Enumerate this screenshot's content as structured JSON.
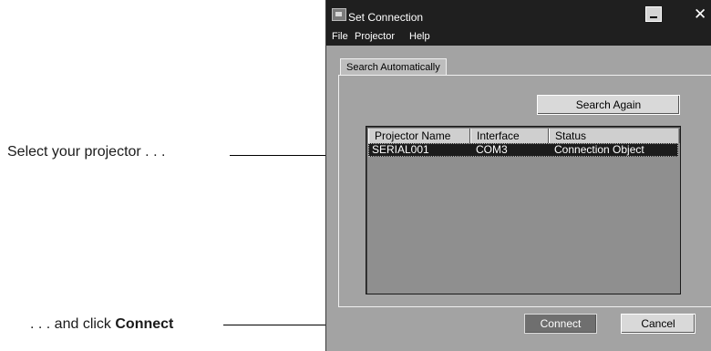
{
  "callouts": {
    "select": "Select your projector . . .",
    "click_prefix": ". . . and click ",
    "click_bold": "Connect"
  },
  "window": {
    "title": "Set Connection",
    "close_glyph": "✕",
    "icons": [
      "app-icon",
      "minimize-icon",
      "close-icon"
    ]
  },
  "menu": {
    "items": [
      "File",
      "Projector",
      "Help"
    ]
  },
  "tab": {
    "label": "Search Automatically"
  },
  "buttons": {
    "search_again": "Search Again",
    "connect": "Connect",
    "cancel": "Cancel"
  },
  "list": {
    "columns": [
      "Projector Name",
      "Interface",
      "Status"
    ],
    "rows": [
      [
        "SERIAL001",
        "COM3",
        "Connection Object"
      ]
    ],
    "selected_row": 0
  },
  "colors": {
    "selection": "#1c1c1c",
    "panel": "#a3a3a3"
  }
}
